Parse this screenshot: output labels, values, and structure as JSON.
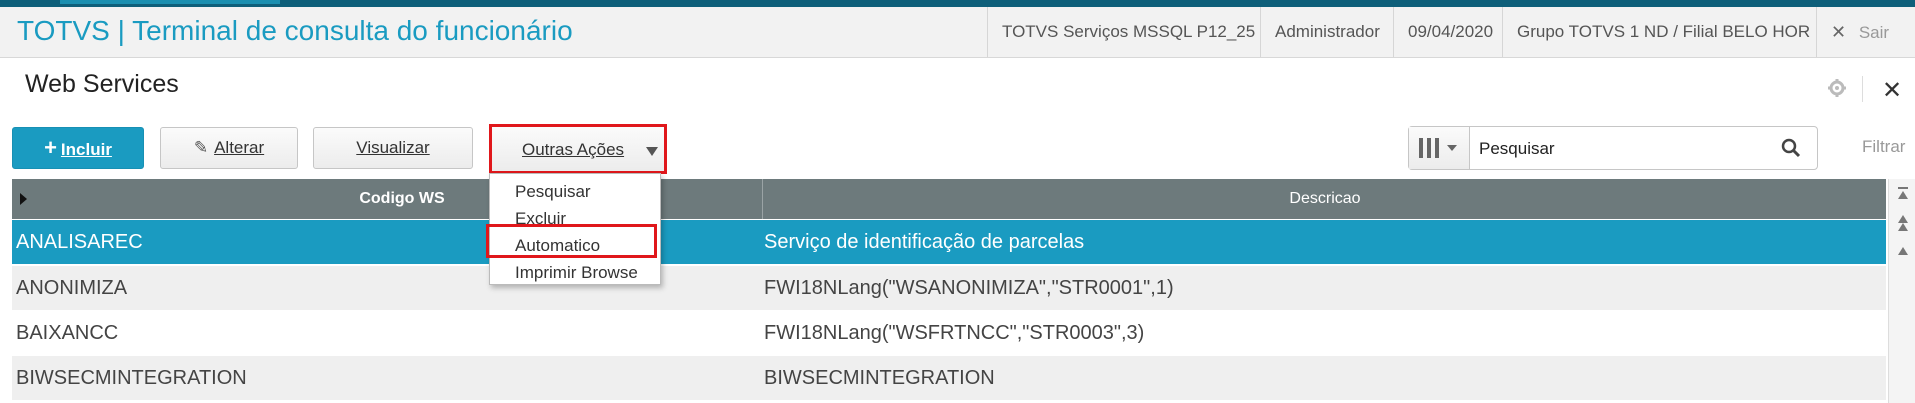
{
  "app": {
    "title": "TOTVS | Terminal de consulta do funcionário",
    "environment": "TOTVS Serviços MSSQL P12_25",
    "user": "Administrador",
    "date": "09/04/2020",
    "branch": "Grupo TOTVS 1 ND / Filial BELO HOR",
    "exit_label": "Sair"
  },
  "page": {
    "title": "Web Services"
  },
  "toolbar": {
    "incluir": "Incluir",
    "alterar": "Alterar",
    "visualizar": "Visualizar",
    "outras_acoes": "Outras Ações"
  },
  "search": {
    "value": "Pesquisar",
    "filter_label": "Filtrar"
  },
  "menu": {
    "items": [
      "Pesquisar",
      "Excluir",
      "Automatico",
      "Imprimir Browse"
    ]
  },
  "grid": {
    "columns": [
      "Codigo WS",
      "Descricao"
    ],
    "rows": [
      {
        "code": "ANALISAREC",
        "desc": "Serviço de identificação de parcelas"
      },
      {
        "code": "ANONIMIZA",
        "desc": "FWI18NLang(\"WSANONIMIZA\",\"STR0001\",1)"
      },
      {
        "code": "BAIXANCC",
        "desc": "FWI18NLang(\"WSFRTNCC\",\"STR0003\",3)"
      },
      {
        "code": "BIWSECMINTEGRATION",
        "desc": "BIWSECMINTEGRATION"
      }
    ]
  },
  "colors": {
    "accent": "#1a9bc1",
    "highlight_border": "#e0171b",
    "grid_header": "#6d7a7c"
  }
}
